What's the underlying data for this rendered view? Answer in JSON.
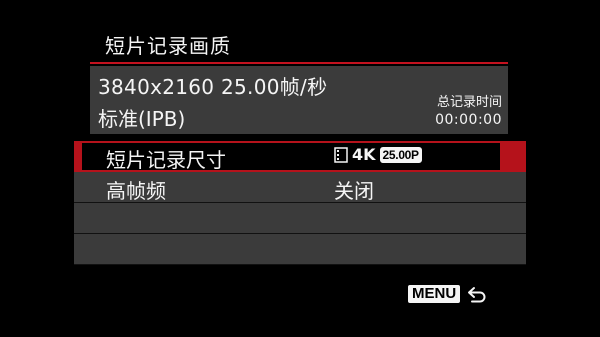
{
  "menu": {
    "title": "短片记录画质"
  },
  "info": {
    "resolution_rate": "3840x2160 25.00帧/秒",
    "compression": "标准(IPB)",
    "total_time_label": "总记录时间",
    "total_time_value": "00:00:00"
  },
  "rows": [
    {
      "label": "短片记录尺寸",
      "value_icons": [
        "film-icon",
        "4k-icon"
      ],
      "value_k": "4K",
      "value_badge": "25.00P",
      "selected": true
    },
    {
      "label": "高帧频",
      "value": "关闭",
      "selected": false
    },
    {
      "label": "",
      "value": ""
    },
    {
      "label": "",
      "value": ""
    }
  ],
  "footer": {
    "menu_label": "MENU",
    "back_icon": "return-arrow-icon"
  },
  "colors": {
    "accent_red": "#b5121b",
    "panel_gray": "#3b3b3b",
    "background": "#000000",
    "text": "#f5f5f5"
  }
}
